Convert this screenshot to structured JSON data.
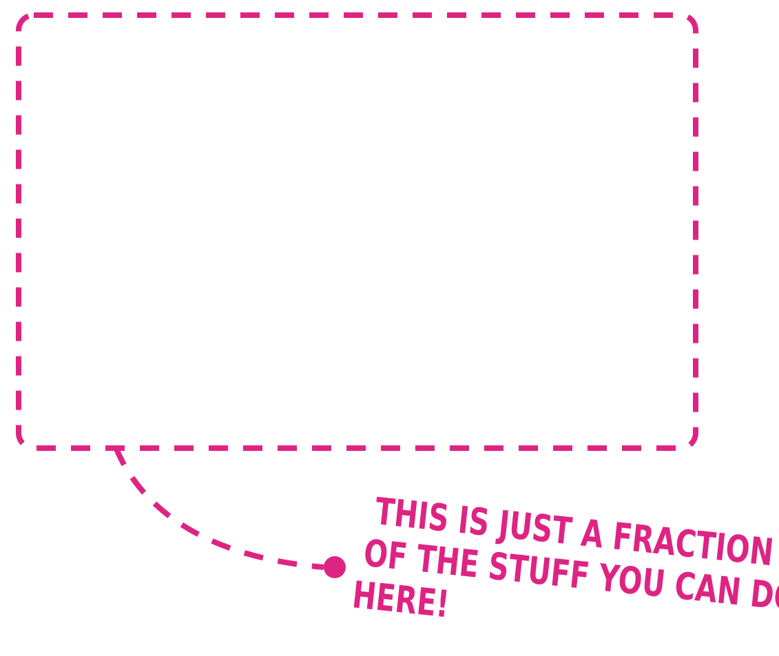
{
  "colors": {
    "accent": "#de2483",
    "background": "#ffffff"
  },
  "caption": {
    "lines": [
      "THIS IS JUST A FRACTION",
      "OF THE STUFF YOU CAN DO",
      "HERE!"
    ]
  }
}
